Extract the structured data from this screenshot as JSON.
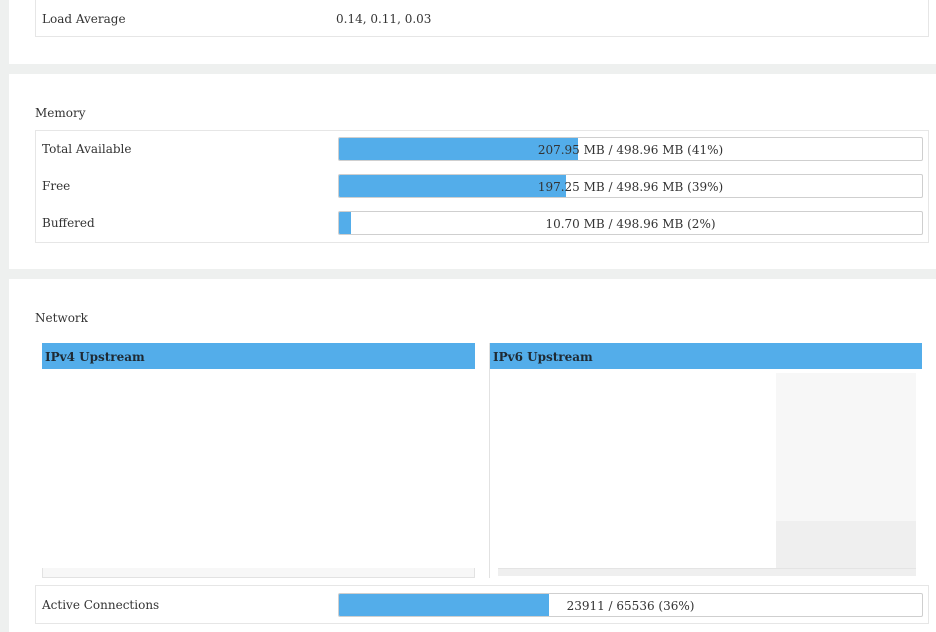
{
  "system": {
    "load_average": {
      "label": "Load Average",
      "value": "0.14, 0.11, 0.03"
    }
  },
  "memory": {
    "title": "Memory",
    "rows": [
      {
        "label": "Total Available",
        "text": "207.95 MB / 498.96 MB (41%)",
        "percent": 41
      },
      {
        "label": "Free",
        "text": "197.25 MB / 498.96 MB (39%)",
        "percent": 39
      },
      {
        "label": "Buffered",
        "text": "10.70 MB / 498.96 MB (2%)",
        "percent": 2
      }
    ]
  },
  "network": {
    "title": "Network",
    "ipv4_title": "IPv4 Upstream",
    "ipv6_title": "IPv6 Upstream",
    "active_connections": {
      "label": "Active Connections",
      "text": "23911 / 65536 (36%)",
      "percent": 36
    }
  },
  "colors": {
    "accent": "#53adea",
    "panel": "#ffffff",
    "background": "#eef0ef"
  }
}
